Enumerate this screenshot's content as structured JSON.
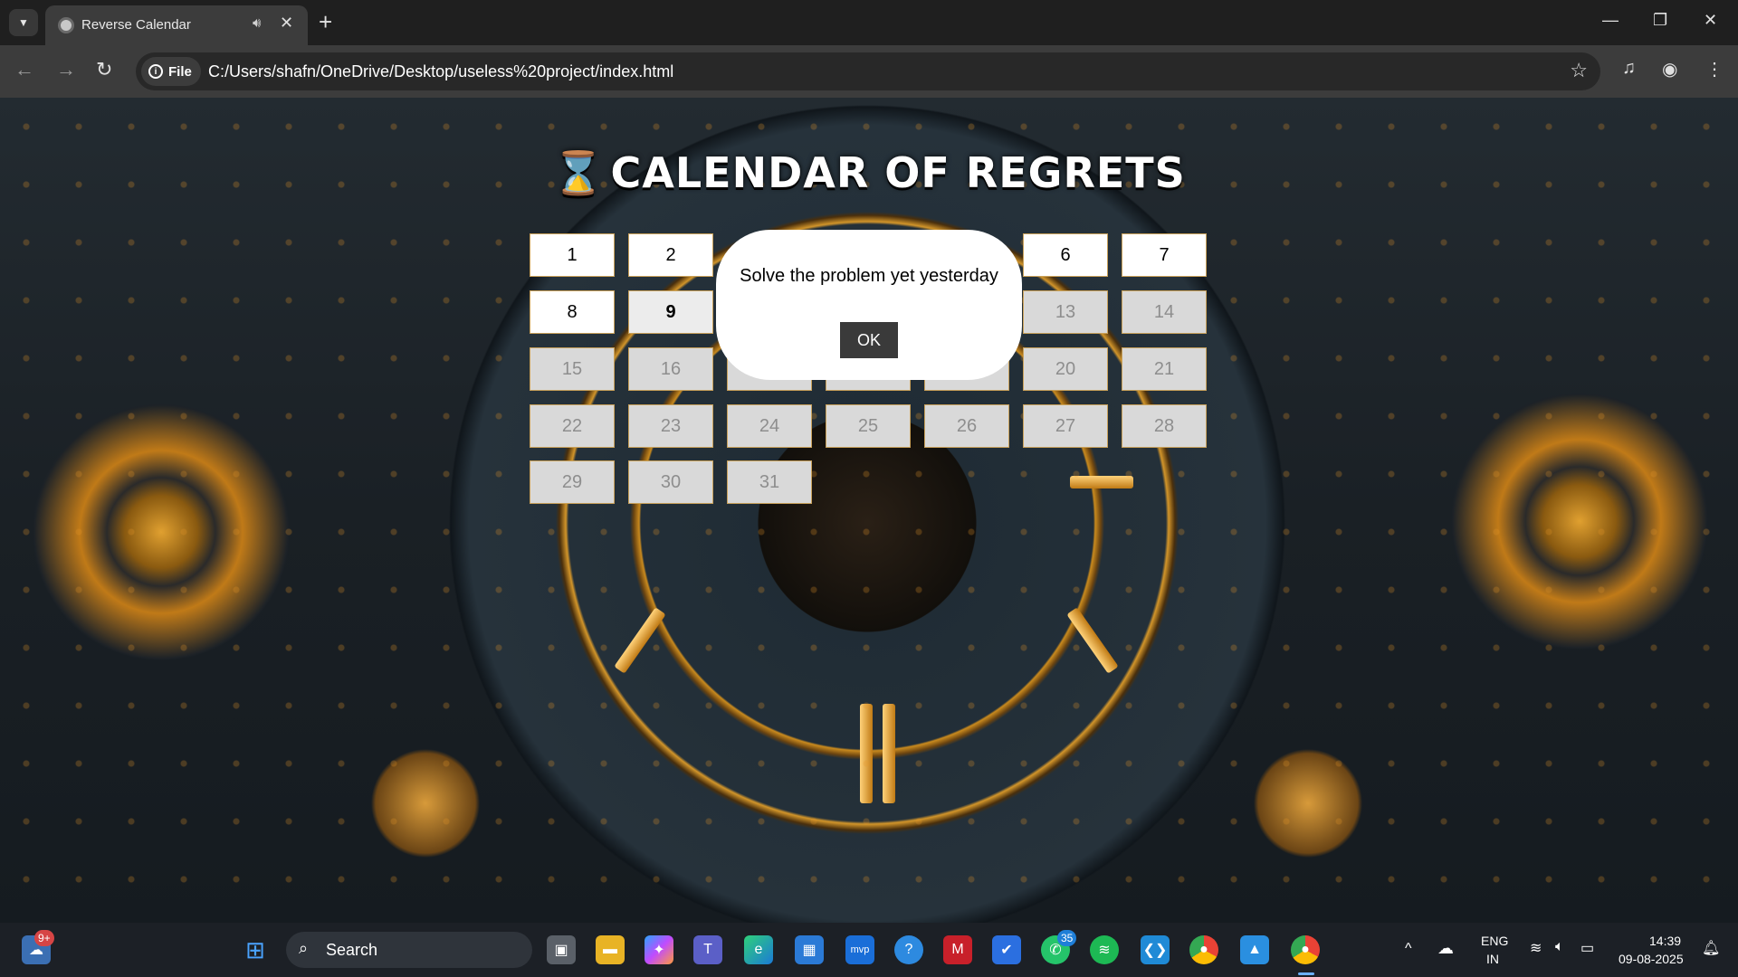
{
  "browser": {
    "tab_title": "Reverse Calendar",
    "new_tab": "+",
    "chip_label": "File",
    "url": "C:/Users/shafn/OneDrive/Desktop/useless%20project/index.html"
  },
  "page": {
    "title": "CALENDAR OF REGRETS",
    "title_icon": "⌛",
    "days": [
      {
        "label": "1",
        "state": "active"
      },
      {
        "label": "2",
        "state": "active"
      },
      {
        "label": "6",
        "state": "active"
      },
      {
        "label": "7",
        "state": "active"
      },
      {
        "label": "8",
        "state": "active"
      },
      {
        "label": "9",
        "state": "today"
      },
      {
        "label": "13",
        "state": "past"
      },
      {
        "label": "14",
        "state": "past"
      },
      {
        "label": "15",
        "state": "past"
      },
      {
        "label": "16",
        "state": "past"
      },
      {
        "label": "20",
        "state": "past"
      },
      {
        "label": "21",
        "state": "past"
      },
      {
        "label": "22",
        "state": "past"
      },
      {
        "label": "23",
        "state": "past"
      },
      {
        "label": "24",
        "state": "past"
      },
      {
        "label": "25",
        "state": "past"
      },
      {
        "label": "26",
        "state": "past"
      },
      {
        "label": "27",
        "state": "past"
      },
      {
        "label": "28",
        "state": "past"
      },
      {
        "label": "29",
        "state": "past"
      },
      {
        "label": "30",
        "state": "past"
      },
      {
        "label": "31",
        "state": "past"
      }
    ],
    "dialog": {
      "message": "Solve the problem yet yesterday",
      "ok_label": "OK"
    }
  },
  "taskbar": {
    "widgets_badge": "9+",
    "search_label": "Search",
    "whatsapp_badge": "35",
    "language": "ENG",
    "region": "IN",
    "time": "14:39",
    "date": "09-08-2025"
  },
  "colors": {
    "chrome_dark": "#1f1f1f",
    "chrome_toolbar": "#3c3c3c",
    "accent_gold": "#c98a1e",
    "dialog_button": "#3a3a3a"
  }
}
